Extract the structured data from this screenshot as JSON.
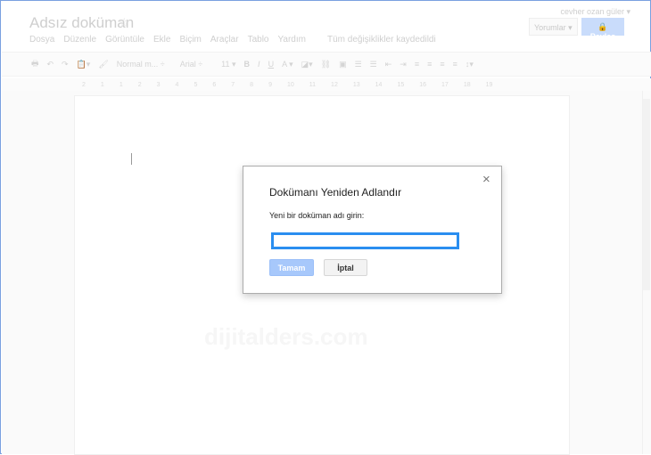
{
  "doc": {
    "title": "Adsız doküman",
    "user": "cevher ozan güler ▾",
    "comments": "Yorumlar ▾",
    "share": "🔒 Paylaş",
    "menu": [
      "Dosya",
      "Düzenle",
      "Görüntüle",
      "Ekle",
      "Biçim",
      "Araçlar",
      "Tablo",
      "Yardım"
    ],
    "saved": "Tüm değişiklikler kaydedildi",
    "toolbar": {
      "style": "Normal m... ÷",
      "font": "Arial ÷",
      "size": "11 ▾",
      "bold": "B",
      "italic": "I",
      "underline": "U",
      "color": "A ▾"
    },
    "ruler": [
      "2",
      "1",
      "1",
      "2",
      "3",
      "4",
      "5",
      "6",
      "7",
      "8",
      "9",
      "10",
      "11",
      "12",
      "13",
      "14",
      "15",
      "16",
      "17",
      "18",
      "19"
    ],
    "watermark": "dijitalders.com"
  },
  "dialog": {
    "title": "Dokümanı Yeniden Adlandır",
    "label": "Yeni bir doküman adı girin:",
    "value": "",
    "ok": "Tamam",
    "cancel": "İptal",
    "close": "×"
  }
}
